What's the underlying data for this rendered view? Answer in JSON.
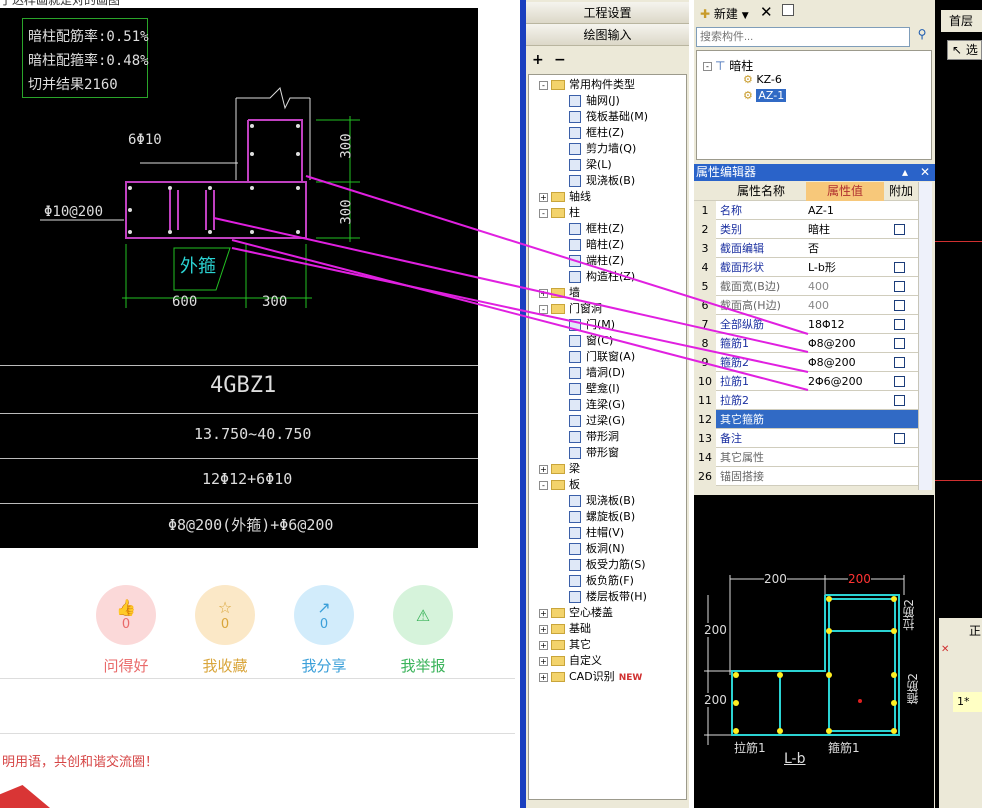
{
  "cad": {
    "info_lines": [
      "暗柱配筋率:0.51%",
      "暗柱配箍率:0.48%",
      "切并结果2160"
    ],
    "label_6phi10": "6Φ10",
    "label_phi10_200": "Φ10@200",
    "label_outer_hoop": "外箍",
    "dim_300_top": "300",
    "dim_300_mid": "300",
    "dim_600": "600",
    "dim_300_bottom": "300",
    "table_name": "4GBZ1",
    "table_elev": "13.750~40.750",
    "table_long": "12Φ12+6Φ10",
    "table_stir": "Φ8@200(外箍)+Φ6@200"
  },
  "actions": [
    {
      "icon": "thumb-up",
      "count": "0",
      "label": "问得好",
      "color": "#e96a6a",
      "bg": "#fbd9d9"
    },
    {
      "icon": "star",
      "count": "0",
      "label": "我收藏",
      "color": "#d9a53a",
      "bg": "#fbe8c7"
    },
    {
      "icon": "share",
      "count": "0",
      "label": "我分享",
      "color": "#3a9fd9",
      "bg": "#d2ecfb"
    },
    {
      "icon": "warning",
      "count": "0",
      "label": "我举报",
      "color": "#3ab35a",
      "bg": "#d6f3db"
    }
  ],
  "footer_text": "明用语，共创和谐交流圈！",
  "top_cut_text": "了达样画就是对的画图",
  "panel": {
    "project_settings": "工程设置",
    "draw_input": "绘图输入",
    "tree": [
      {
        "label": "常用构件类型",
        "level": 0,
        "exp": "-"
      },
      {
        "label": "轴网(J)",
        "level": 1
      },
      {
        "label": "筏板基础(M)",
        "level": 1
      },
      {
        "label": "框柱(Z)",
        "level": 1
      },
      {
        "label": "剪力墙(Q)",
        "level": 1
      },
      {
        "label": "梁(L)",
        "level": 1
      },
      {
        "label": "现浇板(B)",
        "level": 1
      },
      {
        "label": "轴线",
        "level": 0,
        "exp": "+"
      },
      {
        "label": "柱",
        "level": 0,
        "exp": "-"
      },
      {
        "label": "框柱(Z)",
        "level": 1
      },
      {
        "label": "暗柱(Z)",
        "level": 1
      },
      {
        "label": "端柱(Z)",
        "level": 1
      },
      {
        "label": "构造柱(Z)",
        "level": 1
      },
      {
        "label": "墙",
        "level": 0,
        "exp": "+"
      },
      {
        "label": "门窗洞",
        "level": 0,
        "exp": "-"
      },
      {
        "label": "门(M)",
        "level": 1
      },
      {
        "label": "窗(C)",
        "level": 1
      },
      {
        "label": "门联窗(A)",
        "level": 1
      },
      {
        "label": "墙洞(D)",
        "level": 1
      },
      {
        "label": "壁龛(I)",
        "level": 1
      },
      {
        "label": "连梁(G)",
        "level": 1
      },
      {
        "label": "过梁(G)",
        "level": 1
      },
      {
        "label": "带形洞",
        "level": 1
      },
      {
        "label": "带形窗",
        "level": 1
      },
      {
        "label": "梁",
        "level": 0,
        "exp": "+"
      },
      {
        "label": "板",
        "level": 0,
        "exp": "-"
      },
      {
        "label": "现浇板(B)",
        "level": 1
      },
      {
        "label": "螺旋板(B)",
        "level": 1
      },
      {
        "label": "柱帽(V)",
        "level": 1
      },
      {
        "label": "板洞(N)",
        "level": 1
      },
      {
        "label": "板受力筋(S)",
        "level": 1
      },
      {
        "label": "板负筋(F)",
        "level": 1
      },
      {
        "label": "楼层板带(H)",
        "level": 1
      },
      {
        "label": "空心楼盖",
        "level": 0,
        "exp": "+"
      },
      {
        "label": "基础",
        "level": 0,
        "exp": "+"
      },
      {
        "label": "其它",
        "level": 0,
        "exp": "+"
      },
      {
        "label": "自定义",
        "level": 0,
        "exp": "+"
      },
      {
        "label": "CAD识别",
        "level": 0,
        "exp": "+"
      }
    ],
    "new_badge": "NEW"
  },
  "right": {
    "new_btn": "新建",
    "search_placeholder": "搜索构件...",
    "comp_root": "暗柱",
    "comp_items": [
      "KZ-6",
      "AZ-1"
    ],
    "prop_title": "属性编辑器",
    "col_name": "属性名称",
    "col_value": "属性值",
    "col_extra": "附加",
    "rows": [
      {
        "n": "1",
        "name": "名称",
        "value": "AZ-1",
        "chk": false
      },
      {
        "n": "2",
        "name": "类别",
        "value": "暗柱",
        "chk": true
      },
      {
        "n": "3",
        "name": "截面编辑",
        "value": "否",
        "chk": false
      },
      {
        "n": "4",
        "name": "截面形状",
        "value": "L-b形",
        "chk": true
      },
      {
        "n": "5",
        "name": "截面宽(B边)",
        "value": "400",
        "chk": true
      },
      {
        "n": "6",
        "name": "截面高(H边)",
        "value": "400",
        "chk": true
      },
      {
        "n": "7",
        "name": "全部纵筋",
        "value": "18Φ12",
        "chk": true
      },
      {
        "n": "8",
        "name": "箍筋1",
        "value": "Φ8@200",
        "chk": true
      },
      {
        "n": "9",
        "name": "箍筋2",
        "value": "Φ8@200",
        "chk": true
      },
      {
        "n": "10",
        "name": "拉筋1",
        "value": "2Φ6@200",
        "chk": true
      },
      {
        "n": "11",
        "name": "拉筋2",
        "value": "",
        "chk": true
      },
      {
        "n": "12",
        "name": "其它箍筋",
        "value": "",
        "chk": false
      },
      {
        "n": "13",
        "name": "备注",
        "value": "",
        "chk": true
      },
      {
        "n": "14",
        "name": "其它属性",
        "value": "",
        "chk": false
      },
      {
        "n": "26",
        "name": "锚固搭接",
        "value": "",
        "chk": false
      }
    ],
    "preview": {
      "dim_200_a": "200",
      "dim_200_b": "200",
      "dim_200_left_top": "200",
      "dim_200_left_bot": "200",
      "label_tie2": "拉筋2",
      "label_hoop2": "箍筋2",
      "label_tie1": "拉筋1",
      "label_hoop1": "箍筋1",
      "shape_name": "L-b"
    }
  },
  "far_right": {
    "floor": "首层",
    "select": "选",
    "row_label": "1*",
    "correct": "正"
  }
}
